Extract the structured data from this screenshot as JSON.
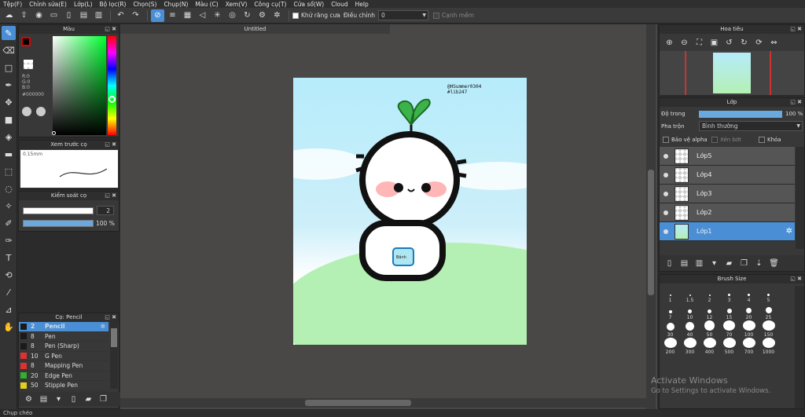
{
  "menu": [
    "Tệp(F)",
    "Chỉnh sửa(E)",
    "Lớp(L)",
    "Bộ lọc(R)",
    "Chọn(S)",
    "Chụp(N)",
    "Màu (C)",
    "Xem(V)",
    "Công cụ(T)",
    "Cửa sổ(W)",
    "Cloud",
    "Help"
  ],
  "toolbar": {
    "antialias_label": "Khử răng cưa",
    "adjust_label": "Điều chỉnh",
    "adjust_value": "0",
    "edge_label": "Cạnh mềm"
  },
  "color_panel": {
    "title": "Màu",
    "r": "R:0",
    "g": "G:0",
    "b": "B:0",
    "hex": "#000000"
  },
  "preview_panel": {
    "title": "Xem trước cọ",
    "size": "0.15mm"
  },
  "control_panel": {
    "title": "Kiểm soát cọ",
    "size_value": "2",
    "opacity_value": "100 %"
  },
  "brush_panel": {
    "title": "Cọ: Pencil",
    "items": [
      {
        "size": "2",
        "name": "Pencil",
        "color": "#1a1a1a"
      },
      {
        "size": "8",
        "name": "Pen",
        "color": "#1a1a1a"
      },
      {
        "size": "8",
        "name": "Pen (Sharp)",
        "color": "#1a1a1a"
      },
      {
        "size": "10",
        "name": "G Pen",
        "color": "#e03030"
      },
      {
        "size": "8",
        "name": "Mapping Pen",
        "color": "#e03030"
      },
      {
        "size": "20",
        "name": "Edge Pen",
        "color": "#30b030"
      },
      {
        "size": "50",
        "name": "Stipple Pen",
        "color": "#e0d020"
      }
    ]
  },
  "document": {
    "title": "Untitled"
  },
  "artwork": {
    "signature": "@HSummer0304\n#lib247",
    "bottle_label": "Bánh"
  },
  "navigator": {
    "title": "Hoa tiêu"
  },
  "layer_panel": {
    "title": "Lớp",
    "opacity_label": "Độ trong",
    "opacity_value": "100 %",
    "blend_label": "Pha trộn",
    "blend_value": "Bình thường",
    "protect_alpha": "Bảo vệ alpha",
    "clipping": "Xén bớt",
    "lock": "Khóa",
    "layers": [
      {
        "name": "Lớp5"
      },
      {
        "name": "Lớp4"
      },
      {
        "name": "Lớp3"
      },
      {
        "name": "Lớp2"
      },
      {
        "name": "Lớp1"
      }
    ]
  },
  "brush_size": {
    "title": "Brush Size",
    "sizes": [
      "1",
      "1.5",
      "2",
      "3",
      "4",
      "5",
      "7",
      "10",
      "12",
      "15",
      "20",
      "25",
      "30",
      "40",
      "50",
      "70",
      "100",
      "150",
      "200",
      "300",
      "400",
      "500",
      "700",
      "1000"
    ]
  },
  "watermark": {
    "line1": "Activate Windows",
    "line2": "Go to Settings to activate Windows."
  },
  "status": "Chụp chéo"
}
